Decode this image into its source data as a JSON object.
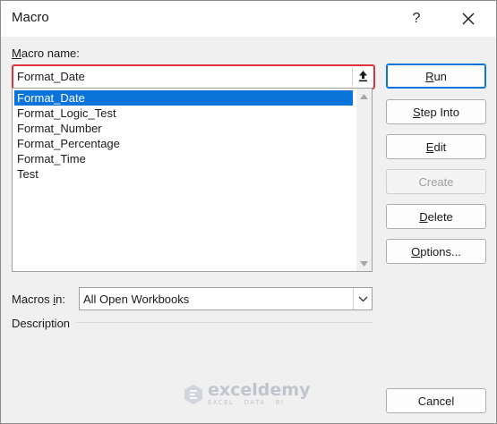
{
  "window": {
    "title": "Macro",
    "help_label": "?"
  },
  "macro_name": {
    "label_accel": "M",
    "label_rest": "acro name:",
    "value": "Format_Date"
  },
  "macro_list": {
    "items": [
      {
        "label": "Format_Date",
        "selected": true
      },
      {
        "label": "Format_Logic_Test",
        "selected": false
      },
      {
        "label": "Format_Number",
        "selected": false
      },
      {
        "label": "Format_Percentage",
        "selected": false
      },
      {
        "label": "Format_Time",
        "selected": false
      },
      {
        "label": "Test",
        "selected": false
      }
    ]
  },
  "buttons": {
    "run": {
      "accel": "R",
      "rest": "un"
    },
    "step_into": {
      "accel": "S",
      "rest": "tep Into"
    },
    "edit": {
      "accel": "E",
      "rest": "dit"
    },
    "create": {
      "label": "Create"
    },
    "delete": {
      "accel": "D",
      "rest": "elete"
    },
    "options": {
      "accel": "O",
      "rest": "ptions..."
    },
    "cancel": {
      "label": "Cancel"
    }
  },
  "macros_in": {
    "label_before": "Macros ",
    "label_accel": "i",
    "label_after": "n:",
    "value": "All Open Workbooks"
  },
  "description": {
    "label": "Description"
  },
  "watermark": {
    "name": "exceldemy",
    "tagline": "EXCEL · DATA · BI"
  },
  "colors": {
    "highlight": "#e0323a",
    "selection": "#0a74da"
  }
}
